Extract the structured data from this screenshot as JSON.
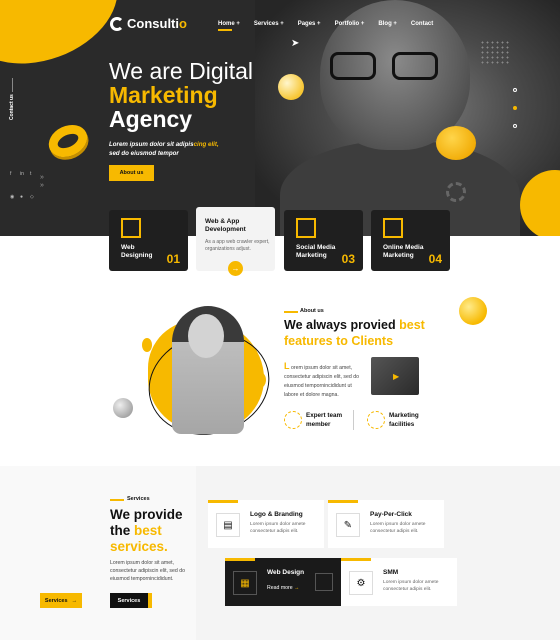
{
  "brand": {
    "logo_text_main": "Consulti",
    "logo_text_accent": "o"
  },
  "nav": {
    "items": [
      "Home +",
      "Services +",
      "Pages +",
      "Portfolio +",
      "Blog +",
      "Contact"
    ],
    "active_index": 0
  },
  "sidebar": {
    "contact_label": "Contact us"
  },
  "hero": {
    "title_line1": "We are Digital",
    "title_line2": "Marketing",
    "title_line3": "Agency",
    "subtitle_plain": "Lorem ipsum dolor sit adipis",
    "subtitle_accent": "cing elit,",
    "subtitle_line2": "sed do eiusmod tempor",
    "button_label": "About us"
  },
  "feature_cards": [
    {
      "title": "Web Designing",
      "number": "01"
    },
    {
      "title": "Web & App Development",
      "description": "As a app web crawler expert, organizations adjust."
    },
    {
      "title": "Social Media Marketing",
      "number": "03"
    },
    {
      "title": "Online Media Marketing",
      "number": "04"
    }
  ],
  "about": {
    "eyebrow": "About us",
    "title_plain": "We always provied ",
    "title_accent": "best",
    "title_line2": "features to Clients",
    "dropcap": "L",
    "text": "orem ipsum dolor sit amet, consectetur adipiscin elit, sed do eiusmod tempornincididunt ut labore et dolore magna.",
    "features": [
      {
        "label_1": "Expert team",
        "label_2": "member"
      },
      {
        "label_1": "Marketing",
        "label_2": "facilities"
      }
    ]
  },
  "services": {
    "eyebrow": "Services",
    "title_line1": "We provide",
    "title_line2_plain": "the ",
    "title_line2_accent": "best",
    "title_line3": "services.",
    "text": "Lorem ipsum dolor sit amet, consectetur adipiscin elit, sed do eiusmod tempornincididunt.",
    "button_primary": "Services",
    "button_secondary": "Services",
    "cards": [
      {
        "title": "Logo & Branding",
        "description": "Lorem ipsum dolor amete consectetur adipis elit."
      },
      {
        "title": "Pay-Per-Click",
        "description": "Lorem ipsum dolor amete consectetur adipis elit."
      },
      {
        "title": "Web Design",
        "read_more": "Read more"
      },
      {
        "title": "SMM",
        "description": "Lorem ipsum dolor amete consectetur adipis elit."
      }
    ]
  },
  "colors": {
    "accent": "#f7b900",
    "dark": "#1f1f1f",
    "light_bg": "#f4f4f4"
  },
  "icons": [
    "logo-icon",
    "paper-plane-icon",
    "gear-icon",
    "arrow-right-icon",
    "play-icon",
    "facebook-icon",
    "twitter-icon",
    "linkedin-icon"
  ]
}
